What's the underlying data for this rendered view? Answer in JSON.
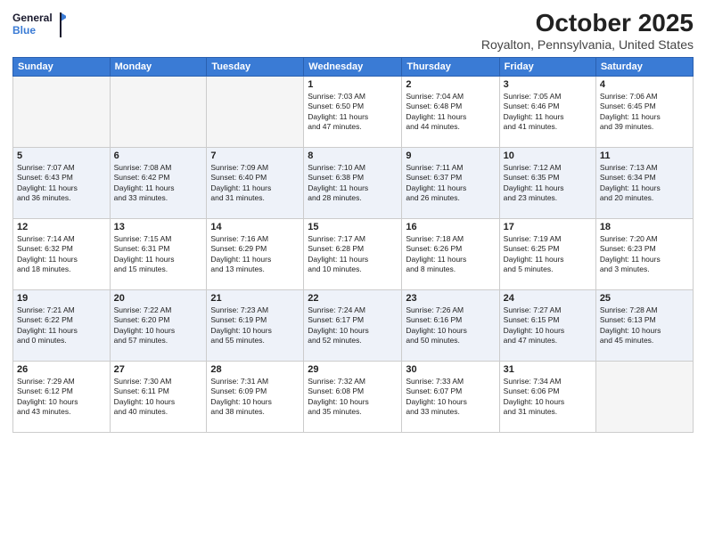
{
  "logo": {
    "line1": "General",
    "line2": "Blue"
  },
  "title": "October 2025",
  "location": "Royalton, Pennsylvania, United States",
  "weekdays": [
    "Sunday",
    "Monday",
    "Tuesday",
    "Wednesday",
    "Thursday",
    "Friday",
    "Saturday"
  ],
  "weeks": [
    [
      {
        "day": "",
        "info": ""
      },
      {
        "day": "",
        "info": ""
      },
      {
        "day": "",
        "info": ""
      },
      {
        "day": "1",
        "info": "Sunrise: 7:03 AM\nSunset: 6:50 PM\nDaylight: 11 hours\nand 47 minutes."
      },
      {
        "day": "2",
        "info": "Sunrise: 7:04 AM\nSunset: 6:48 PM\nDaylight: 11 hours\nand 44 minutes."
      },
      {
        "day": "3",
        "info": "Sunrise: 7:05 AM\nSunset: 6:46 PM\nDaylight: 11 hours\nand 41 minutes."
      },
      {
        "day": "4",
        "info": "Sunrise: 7:06 AM\nSunset: 6:45 PM\nDaylight: 11 hours\nand 39 minutes."
      }
    ],
    [
      {
        "day": "5",
        "info": "Sunrise: 7:07 AM\nSunset: 6:43 PM\nDaylight: 11 hours\nand 36 minutes."
      },
      {
        "day": "6",
        "info": "Sunrise: 7:08 AM\nSunset: 6:42 PM\nDaylight: 11 hours\nand 33 minutes."
      },
      {
        "day": "7",
        "info": "Sunrise: 7:09 AM\nSunset: 6:40 PM\nDaylight: 11 hours\nand 31 minutes."
      },
      {
        "day": "8",
        "info": "Sunrise: 7:10 AM\nSunset: 6:38 PM\nDaylight: 11 hours\nand 28 minutes."
      },
      {
        "day": "9",
        "info": "Sunrise: 7:11 AM\nSunset: 6:37 PM\nDaylight: 11 hours\nand 26 minutes."
      },
      {
        "day": "10",
        "info": "Sunrise: 7:12 AM\nSunset: 6:35 PM\nDaylight: 11 hours\nand 23 minutes."
      },
      {
        "day": "11",
        "info": "Sunrise: 7:13 AM\nSunset: 6:34 PM\nDaylight: 11 hours\nand 20 minutes."
      }
    ],
    [
      {
        "day": "12",
        "info": "Sunrise: 7:14 AM\nSunset: 6:32 PM\nDaylight: 11 hours\nand 18 minutes."
      },
      {
        "day": "13",
        "info": "Sunrise: 7:15 AM\nSunset: 6:31 PM\nDaylight: 11 hours\nand 15 minutes."
      },
      {
        "day": "14",
        "info": "Sunrise: 7:16 AM\nSunset: 6:29 PM\nDaylight: 11 hours\nand 13 minutes."
      },
      {
        "day": "15",
        "info": "Sunrise: 7:17 AM\nSunset: 6:28 PM\nDaylight: 11 hours\nand 10 minutes."
      },
      {
        "day": "16",
        "info": "Sunrise: 7:18 AM\nSunset: 6:26 PM\nDaylight: 11 hours\nand 8 minutes."
      },
      {
        "day": "17",
        "info": "Sunrise: 7:19 AM\nSunset: 6:25 PM\nDaylight: 11 hours\nand 5 minutes."
      },
      {
        "day": "18",
        "info": "Sunrise: 7:20 AM\nSunset: 6:23 PM\nDaylight: 11 hours\nand 3 minutes."
      }
    ],
    [
      {
        "day": "19",
        "info": "Sunrise: 7:21 AM\nSunset: 6:22 PM\nDaylight: 11 hours\nand 0 minutes."
      },
      {
        "day": "20",
        "info": "Sunrise: 7:22 AM\nSunset: 6:20 PM\nDaylight: 10 hours\nand 57 minutes."
      },
      {
        "day": "21",
        "info": "Sunrise: 7:23 AM\nSunset: 6:19 PM\nDaylight: 10 hours\nand 55 minutes."
      },
      {
        "day": "22",
        "info": "Sunrise: 7:24 AM\nSunset: 6:17 PM\nDaylight: 10 hours\nand 52 minutes."
      },
      {
        "day": "23",
        "info": "Sunrise: 7:26 AM\nSunset: 6:16 PM\nDaylight: 10 hours\nand 50 minutes."
      },
      {
        "day": "24",
        "info": "Sunrise: 7:27 AM\nSunset: 6:15 PM\nDaylight: 10 hours\nand 47 minutes."
      },
      {
        "day": "25",
        "info": "Sunrise: 7:28 AM\nSunset: 6:13 PM\nDaylight: 10 hours\nand 45 minutes."
      }
    ],
    [
      {
        "day": "26",
        "info": "Sunrise: 7:29 AM\nSunset: 6:12 PM\nDaylight: 10 hours\nand 43 minutes."
      },
      {
        "day": "27",
        "info": "Sunrise: 7:30 AM\nSunset: 6:11 PM\nDaylight: 10 hours\nand 40 minutes."
      },
      {
        "day": "28",
        "info": "Sunrise: 7:31 AM\nSunset: 6:09 PM\nDaylight: 10 hours\nand 38 minutes."
      },
      {
        "day": "29",
        "info": "Sunrise: 7:32 AM\nSunset: 6:08 PM\nDaylight: 10 hours\nand 35 minutes."
      },
      {
        "day": "30",
        "info": "Sunrise: 7:33 AM\nSunset: 6:07 PM\nDaylight: 10 hours\nand 33 minutes."
      },
      {
        "day": "31",
        "info": "Sunrise: 7:34 AM\nSunset: 6:06 PM\nDaylight: 10 hours\nand 31 minutes."
      },
      {
        "day": "",
        "info": ""
      }
    ]
  ]
}
